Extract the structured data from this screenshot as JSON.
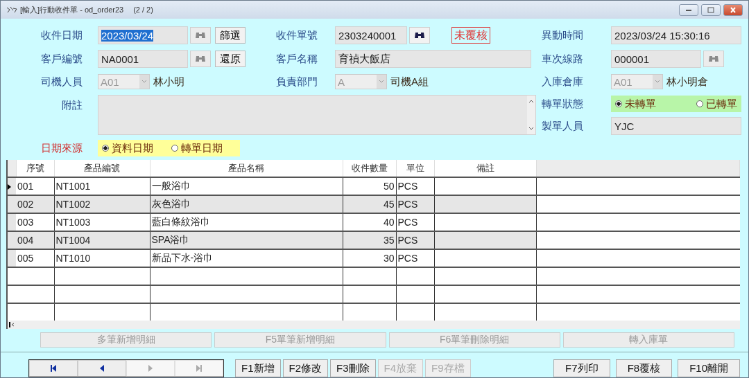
{
  "window": {
    "title": "[輸入]行動收件單 - od_order23",
    "record": "(2 / 2)"
  },
  "receive_date": {
    "label": "收件日期",
    "value": "2023/03/24",
    "highlighted": true,
    "lookup": {
      "disabled": true
    },
    "button": "篩選"
  },
  "receipt_no": {
    "label": "收件單號",
    "value": "2303240001",
    "lookup": {
      "disabled": false
    },
    "review_status": "未覆核"
  },
  "modified_time": {
    "label": "異動時間",
    "value": "2023/03/24 15:30:16"
  },
  "customer_code": {
    "label": "客戶編號",
    "value": "NA0001",
    "highlighted": false,
    "lookup": {
      "disabled": true
    },
    "button": "還原"
  },
  "customer_name": {
    "label": "客戶名稱",
    "value": "育禎大飯店"
  },
  "route": {
    "label": "車次線路",
    "value": "000001",
    "lookup": {
      "disabled": true
    }
  },
  "driver": {
    "label": "司機人員",
    "value": "A01",
    "disabled": true,
    "name": "林小明"
  },
  "department": {
    "label": "負責部門",
    "value": "A",
    "disabled": true,
    "name": "司機A組"
  },
  "warehouse": {
    "label": "入庫倉庫",
    "value": "A01",
    "disabled": true,
    "name": "林小明倉"
  },
  "notes": {
    "label": "附註"
  },
  "transfer_status": {
    "label": "轉單狀態",
    "options": [
      {
        "label": "未轉單",
        "selected": true
      },
      {
        "label": "已轉單",
        "selected": false
      }
    ]
  },
  "creator": {
    "label": "製單人員",
    "value": "YJC"
  },
  "date_source": {
    "label": "日期來源",
    "options": [
      {
        "label": "資料日期",
        "selected": true
      },
      {
        "label": "轉單日期",
        "selected": false
      }
    ]
  },
  "table": {
    "columns": [
      {
        "label": "序號"
      },
      {
        "label": "產品編號"
      },
      {
        "label": "產品名稱"
      },
      {
        "label": "收件數量",
        "numeric": true
      },
      {
        "label": "單位"
      },
      {
        "label": "備註"
      }
    ],
    "rows": [
      {
        "selected": true,
        "cells": [
          "001",
          "NT1001",
          "一般浴巾",
          "50",
          "PCS",
          ""
        ]
      },
      {
        "selected": false,
        "cells": [
          "002",
          "NT1002",
          "灰色浴巾",
          "45",
          "PCS",
          ""
        ]
      },
      {
        "selected": false,
        "cells": [
          "003",
          "NT1003",
          "藍白條紋浴巾",
          "40",
          "PCS",
          ""
        ]
      },
      {
        "selected": false,
        "cells": [
          "004",
          "NT1004",
          "SPA浴巾",
          "35",
          "PCS",
          ""
        ]
      },
      {
        "selected": false,
        "cells": [
          "005",
          "NT1010",
          "新品下水-浴巾",
          "30",
          "PCS",
          ""
        ]
      }
    ]
  },
  "detail_buttons": [
    {
      "label": "多筆新增明細",
      "disabled": true
    },
    {
      "label": "F5單筆新增明細",
      "disabled": true
    },
    {
      "label": "F6單筆刪除明細",
      "disabled": true
    },
    {
      "label": "轉入庫單",
      "disabled": true
    }
  ],
  "navigation": [
    {
      "kind": "first",
      "disabled": false
    },
    {
      "kind": "prev",
      "disabled": false
    },
    {
      "kind": "next",
      "disabled": true
    },
    {
      "kind": "last",
      "disabled": true
    }
  ],
  "actions": [
    {
      "label": "F1新增",
      "disabled": false
    },
    {
      "label": "F2修改",
      "disabled": false
    },
    {
      "label": "F3刪除",
      "disabled": false
    },
    {
      "label": "F4放棄",
      "disabled": true
    },
    {
      "label": "F9存檔",
      "disabled": true
    }
  ],
  "actions_right": [
    {
      "label": "F7列印",
      "disabled": false
    },
    {
      "label": "F8覆核",
      "disabled": false
    },
    {
      "label": "F10離開",
      "disabled": false
    }
  ]
}
